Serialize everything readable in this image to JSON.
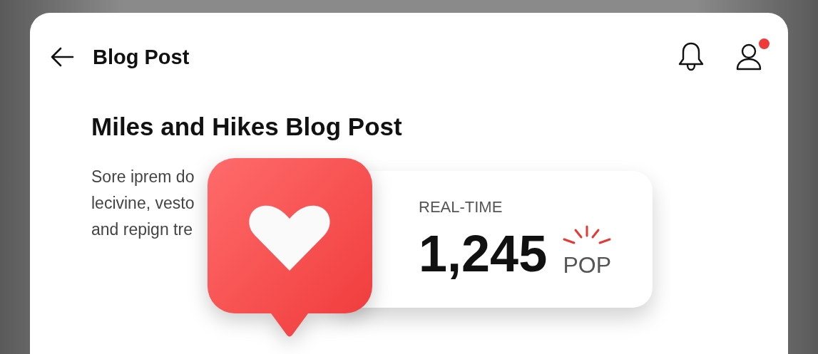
{
  "header": {
    "title": "Blog Post",
    "profile_badge": true
  },
  "post": {
    "title": "Miles and Hikes Blog Post",
    "lines": [
      "Sore iprem do",
      "lecivine, vesto",
      "and repign tre"
    ]
  },
  "stat_card": {
    "label": "REAL-TIME",
    "count": "1,245",
    "unit": "POP"
  }
}
